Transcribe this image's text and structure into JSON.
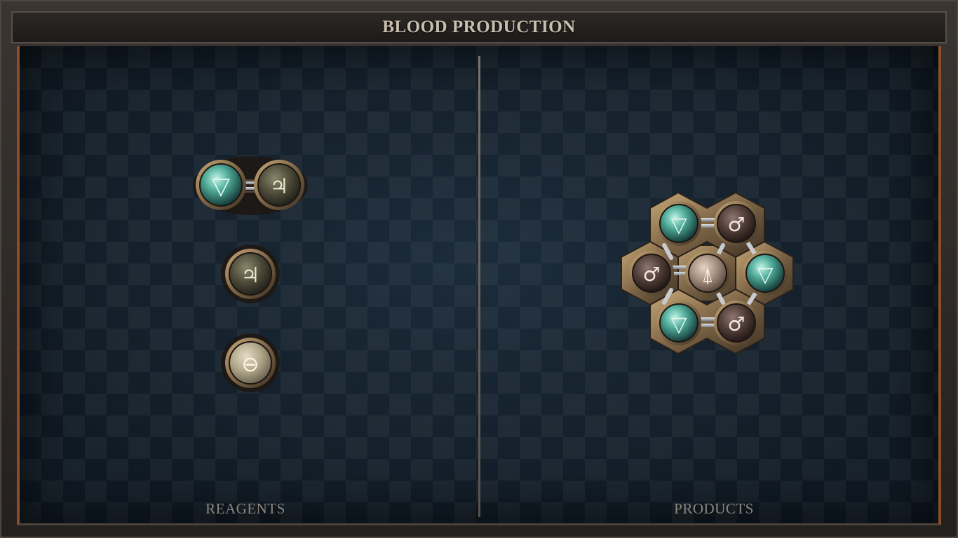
{
  "title": "BLOOD PRODUCTION",
  "sections": {
    "reagents_label": "REAGENTS",
    "products_label": "PRODUCTS"
  },
  "atoms": {
    "water": {
      "symbol": "▽",
      "icon": "water-triangle-icon",
      "color": "#5fb8a6"
    },
    "salt": {
      "symbol": "⊖",
      "icon": "salt-icon",
      "color": "#b6ac8e"
    },
    "iron": {
      "symbol": "♂",
      "icon": "iron-mars-icon",
      "color": "#5c4741"
    },
    "tin": {
      "symbol": "♃",
      "icon": "tin-jupiter-icon",
      "color": "#5e5a45"
    },
    "vitae": {
      "symbol": "⍋",
      "icon": "vitae-icon",
      "color": "#a58f80"
    }
  },
  "reagents": [
    {
      "name": "water-tin-molecule",
      "atoms": [
        "water",
        "tin"
      ]
    },
    {
      "name": "tin-molecule",
      "atoms": [
        "tin"
      ]
    },
    {
      "name": "salt-molecule",
      "atoms": [
        "salt"
      ]
    }
  ],
  "products": [
    {
      "name": "blood-molecule",
      "atoms": [
        "vitae",
        "water",
        "iron",
        "water",
        "water",
        "iron",
        "iron"
      ]
    }
  ]
}
